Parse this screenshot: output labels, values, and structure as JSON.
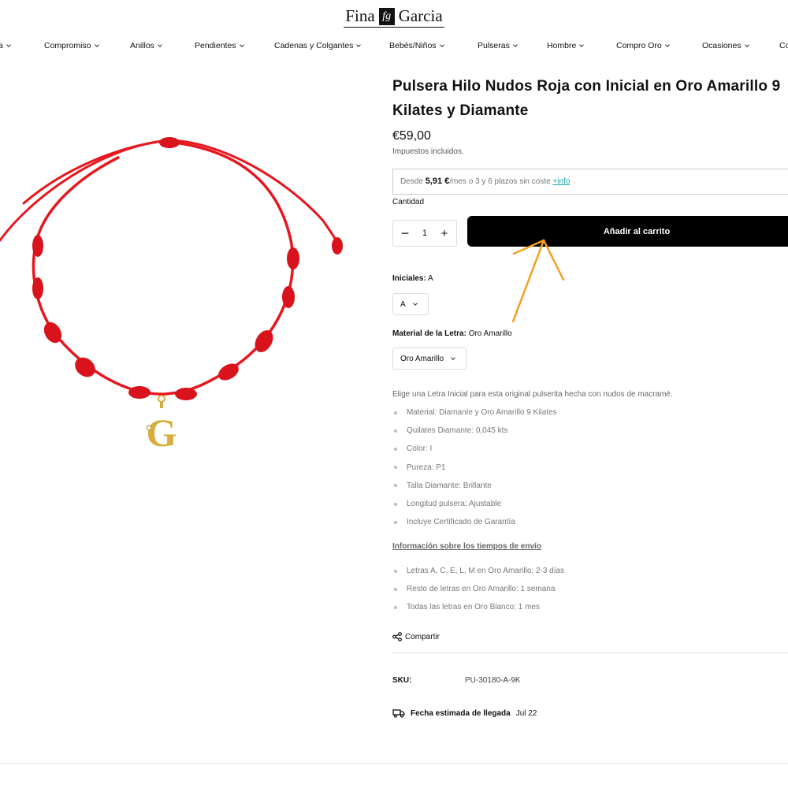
{
  "brand": {
    "name_left": "Fina",
    "mark": "fg",
    "name_right": "Garcia"
  },
  "nav": [
    {
      "label": "a"
    },
    {
      "label": "Compromiso"
    },
    {
      "label": "Anillos"
    },
    {
      "label": "Pendientes"
    },
    {
      "label": "Cadenas y Colgantes"
    },
    {
      "label": "Bebés/Niños"
    },
    {
      "label": "Pulseras"
    },
    {
      "label": "Hombre"
    },
    {
      "label": "Compro Oro"
    },
    {
      "label": "Ocasiones"
    },
    {
      "label": "Co"
    }
  ],
  "product": {
    "title": "Pulsera Hilo Nudos Roja con Inicial en Oro Amarillo 9 Kilates y Diamante",
    "price": "€59,00",
    "tax_note": "Impuestos incluidos.",
    "pendant_letter": "G",
    "cord_color": "#e8161e",
    "gold_color": "#d7ad3e"
  },
  "installments": {
    "prefix": "Desde",
    "amount": "5,91 €",
    "suffix": "/mes o 3 y 6 plazos sin coste",
    "more_link": "+info"
  },
  "quantity": {
    "label": "Cantidad",
    "value": "1",
    "minus": "−",
    "plus": "+"
  },
  "cart_button": "Añadir al carrito",
  "options": {
    "initials": {
      "label": "Iniciales:",
      "value": "A",
      "selected": "A"
    },
    "material": {
      "label": "Material de la Letra:",
      "value": "Oro Amarillo",
      "selected": "Oro Amarillo"
    }
  },
  "description": "Elige una Letra Inicial para esta original pulserita hecha con nudos de macramé.",
  "specs": [
    "Material: Diamante y Oro Amarillo 9 Kilates",
    "Quilates Diamante: 0,045 kts",
    "Color: I",
    "Pureza: P1",
    "Talla Diamante: Brillante",
    "Longitud pulsera: Ajustable",
    "Incluye Certificado de Garantía"
  ],
  "shipping": {
    "title": "Información sobre los tiempos de envío",
    "items": [
      "Letras A, C, E, L, M en Oro Amarillo: 2-3 días",
      "Resto de letras en Oro Amarillo: 1 semana",
      "Todas las letras en Oro Blanco: 1 mes"
    ]
  },
  "share_label": "Compartir",
  "sku": {
    "label": "SKU:",
    "value": "PU-30180-A-9K"
  },
  "arrival": {
    "label": "Fecha estimada de llegada",
    "value": "Jul 22"
  },
  "annotation": {
    "arrow_color": "#f5a01f"
  }
}
